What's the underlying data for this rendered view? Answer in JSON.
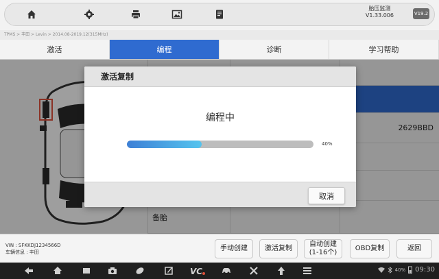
{
  "toolbar": {
    "icons": [
      "home-icon",
      "settings-icon",
      "print-icon",
      "image-icon",
      "report-icon"
    ],
    "app_name": "胎压监测",
    "app_version": "V1.33.006",
    "badge": "V19.2"
  },
  "breadcrumb": "TPMS > 丰田 > Levin > 2014.08-2019.12(315MHz)",
  "tabs": [
    {
      "label": "激活",
      "active": false
    },
    {
      "label": "编程",
      "active": true
    },
    {
      "label": "诊断",
      "active": false
    },
    {
      "label": "学习帮助",
      "active": false
    }
  ],
  "sensor_panel": {
    "sensor_id": "2629BBD",
    "spare_label": "备胎"
  },
  "vehicle": {
    "vin_line": "VIN : SFKKDJ1234566D",
    "info_line": "车辆信息 : 丰田"
  },
  "actions": {
    "manual_create": "手动创建",
    "activate_copy": "激活复制",
    "auto_create_line1": "自动创建",
    "auto_create_line2": "(1-16个)",
    "obd_copy": "OBD复制",
    "back": "返回"
  },
  "dialog": {
    "title": "激活复制",
    "message": "编程中",
    "progress_percent": 40,
    "progress_label": "40%",
    "cancel_label": "取消"
  },
  "system_status": {
    "battery": "40%",
    "time": "09:30"
  },
  "colors": {
    "accent": "#2f6bd0",
    "progress_start": "#3d80d6",
    "progress_end": "#55c4ee",
    "alert_red": "#e0523c"
  }
}
